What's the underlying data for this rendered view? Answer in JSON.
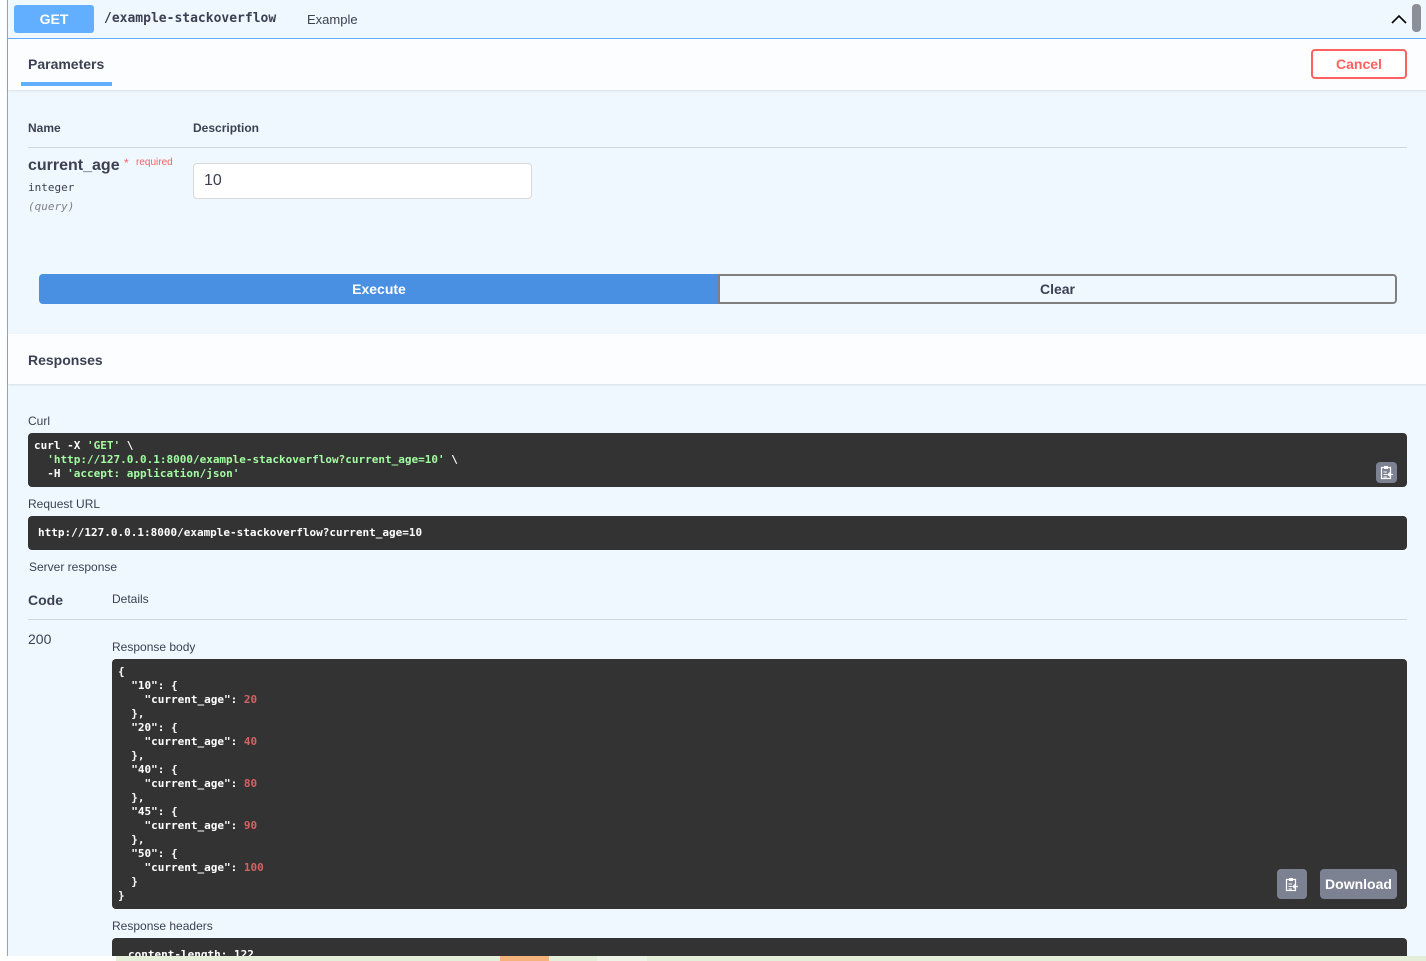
{
  "operation": {
    "method": "GET",
    "path": "/example-stackoverflow",
    "summary": "Example",
    "collapse_icon": "chevron-up-icon"
  },
  "tabs": {
    "parameters_label": "Parameters",
    "cancel_label": "Cancel"
  },
  "parameters_table": {
    "headers": {
      "name": "Name",
      "description": "Description"
    },
    "rows": [
      {
        "name": "current_age",
        "required_star": "*",
        "required_label": "required",
        "type": "integer",
        "location": "(query)",
        "value": "10"
      }
    ]
  },
  "actions": {
    "execute_label": "Execute",
    "clear_label": "Clear"
  },
  "responses": {
    "title": "Responses",
    "curl_label": "Curl",
    "curl": {
      "line1": "curl -X ",
      "line1_method": "'GET'",
      "line1_end": " \\",
      "line2_url": "'http://127.0.0.1:8000/example-stackoverflow?current_age=10'",
      "line2_end": " \\",
      "line3_flag": "  -H ",
      "line3_header": "'accept: application/json'"
    },
    "request_url_label": "Request URL",
    "request_url": "http://127.0.0.1:8000/example-stackoverflow?current_age=10",
    "server_response_label": "Server response",
    "table_headers": {
      "code": "Code",
      "details": "Details"
    },
    "code": "200",
    "response_body_label": "Response body",
    "response_body": [
      {
        "key": "10",
        "current_age": "20"
      },
      {
        "key": "20",
        "current_age": "40"
      },
      {
        "key": "40",
        "current_age": "80"
      },
      {
        "key": "45",
        "current_age": "90"
      },
      {
        "key": "50",
        "current_age": "100"
      }
    ],
    "download_label": "Download",
    "response_headers_label": "Response headers",
    "response_headers_first": "content-length: 122"
  },
  "colors": {
    "get_accent": "#61affe",
    "execute": "#4990e2",
    "cancel": "#ff6060",
    "code_bg": "#333333",
    "string_green": "#a2fca2",
    "number_red": "#d36363"
  }
}
